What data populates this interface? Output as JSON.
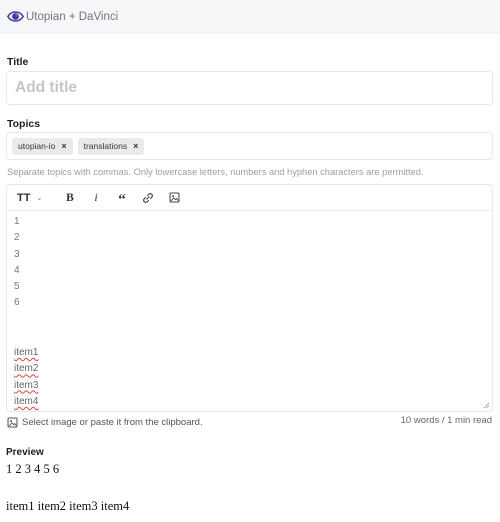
{
  "header": {
    "brand": "Utopian + DaVinci",
    "logo_icon": "eye-logo-icon",
    "accent": "#5b4fc4"
  },
  "title_field": {
    "label": "Title",
    "placeholder": "Add title",
    "value": ""
  },
  "topics_field": {
    "label": "Topics",
    "tags": [
      {
        "text": "utopian-io",
        "remove": "×"
      },
      {
        "text": "translations",
        "remove": "×"
      }
    ],
    "hint": "Separate topics with commas. Only lowercase letters, numbers and hyphen characters are permitted."
  },
  "editor": {
    "toolbar": {
      "heading": "TT",
      "heading_chevron": "⌄",
      "bold": "B",
      "italic": "i",
      "quote": "“",
      "link_icon": "link-icon",
      "image_icon": "image-icon"
    },
    "lines": [
      "1",
      "2",
      "3",
      "4",
      "5",
      "6"
    ],
    "items": [
      "item1",
      "item2",
      "item3",
      "item4"
    ]
  },
  "attach": {
    "text": "Select image or paste it from the clipboard.",
    "icon": "image-icon"
  },
  "stats": {
    "text": "10 words / 1 min read"
  },
  "preview": {
    "label": "Preview",
    "line1": "1 2 3 4 5 6",
    "line2": "item1 item2 item3 item4"
  }
}
